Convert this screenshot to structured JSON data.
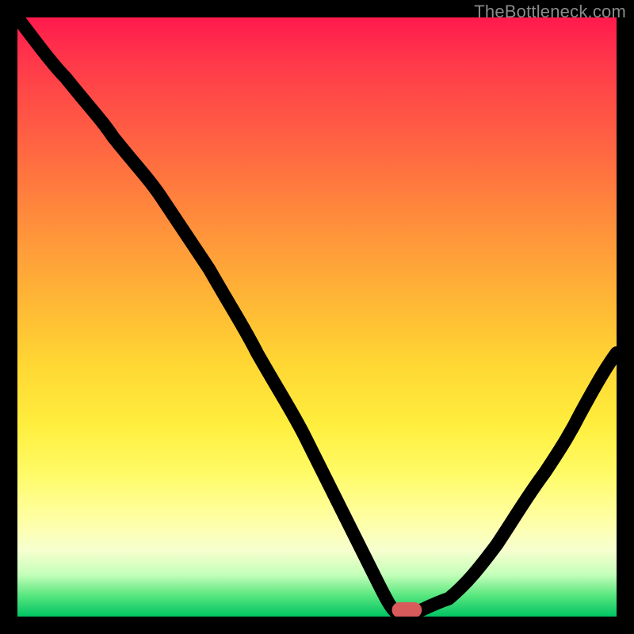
{
  "watermark": "TheBottleneck.com",
  "chart_data": {
    "type": "line",
    "title": "",
    "xlabel": "",
    "ylabel": "",
    "xlim": [
      0,
      100
    ],
    "ylim": [
      0,
      100
    ],
    "x": [
      0,
      8,
      16,
      24,
      32,
      40,
      48,
      55,
      60,
      63,
      66,
      72,
      80,
      88,
      94,
      100
    ],
    "y": [
      100,
      90,
      80,
      70,
      58,
      44,
      30,
      16,
      6,
      1,
      0,
      3,
      12,
      24,
      34,
      44
    ],
    "marker": {
      "x": 65,
      "y": 0.5
    },
    "colors": {
      "gradient_top": "#ff1a4d",
      "gradient_mid": "#ffd733",
      "gradient_bottom": "#00c463",
      "curve": "#000000",
      "marker": "#d85a5a",
      "frame": "#000000"
    }
  }
}
